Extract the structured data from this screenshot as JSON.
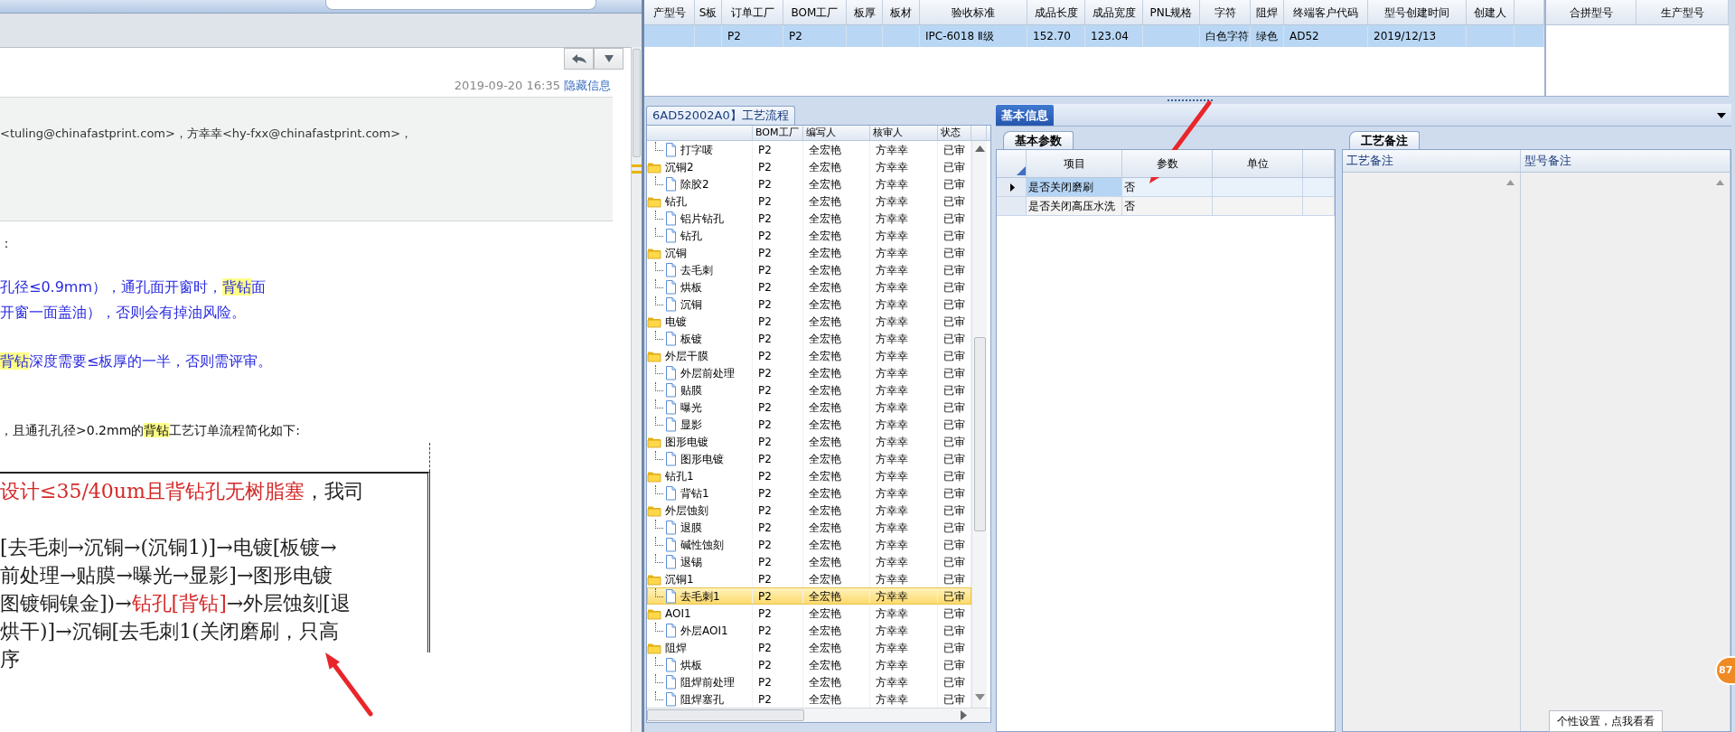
{
  "email": {
    "timestamp": "2019-09-20 16:35",
    "toggle_link": "隐藏信息",
    "recipients": "<tuling@chinafastprint.com>，方幸幸<hy-fxx@chinafastprint.com>，",
    "paragraphs": [
      {
        "kind": "plain",
        "segments": [
          {
            "text": "：",
            "highlight": false
          }
        ]
      },
      {
        "kind": "note",
        "segments": [
          {
            "text": "孔径≤0.9mm），通孔面开窗时，",
            "highlight": false
          },
          {
            "text": "背钻",
            "highlight": true
          },
          {
            "text": "面",
            "highlight": false
          }
        ]
      },
      {
        "kind": "note",
        "segments": [
          {
            "text": "开窗一面盖油），否则会有掉油风险。",
            "highlight": false
          }
        ]
      },
      {
        "kind": "note",
        "segments": [
          {
            "text": "背钻",
            "highlight": true
          },
          {
            "text": "深度需要≤板厚的一半，否则需评审。",
            "highlight": false
          }
        ]
      },
      {
        "kind": "plain",
        "segments": [
          {
            "text": "，且通孔孔径>0.2mm的",
            "highlight": false
          },
          {
            "text": "背钻",
            "highlight": true
          },
          {
            "text": "工艺订单流程简化如下:",
            "highlight": false
          }
        ]
      }
    ],
    "flow_box": [
      [
        {
          "text": "设计≤35/40um且背钻孔无树脂塞",
          "emphasis": true
        },
        {
          "text": "，我司",
          "emphasis": false
        }
      ],
      [
        {
          "text": "[去毛刺→沉铜→(沉铜1)]→电镀[板镀→",
          "emphasis": false
        }
      ],
      [
        {
          "text": "前处理→贴膜→曝光→显影]→图形电镀",
          "emphasis": false
        }
      ],
      [
        {
          "text": "图镀铜镍金])→",
          "emphasis": false
        },
        {
          "text": "钻孔[背钻]",
          "emphasis": true
        },
        {
          "text": "→外层蚀刻[退",
          "emphasis": false
        }
      ],
      [
        {
          "text": "烘干)]→沉铜[去毛刺1(关闭磨刷，只高",
          "emphasis": false
        }
      ],
      [
        {
          "text": "序",
          "emphasis": false
        }
      ]
    ]
  },
  "order_grid": {
    "columns": [
      "产型号",
      "S板",
      "订单工厂",
      "BOM工厂",
      "板厚",
      "板材",
      "验收标准",
      "成品长度",
      "成品宽度",
      "PNL规格",
      "字符",
      "阻焊",
      "终端客户代码",
      "型号创建时间",
      "创建人"
    ],
    "rows": [
      {
        "selected": true,
        "cells": [
          null,
          null,
          "P2",
          "P2",
          null,
          null,
          "IPC-6018 Ⅱ级",
          "152.70",
          "123.04",
          null,
          "白色字符",
          "绿色",
          "AD52",
          "2019/12/13",
          null
        ]
      }
    ]
  },
  "merge_grid": {
    "columns": [
      "合拼型号",
      "生产型号"
    ]
  },
  "process_panel": {
    "tab": "6AD52002A0】工艺流程",
    "columns": [
      "BOM工厂",
      "编写人",
      "核审人",
      "状态"
    ],
    "tree": [
      {
        "kind": "step",
        "name": "打字唛",
        "bom_factory": "P2",
        "author": "全宏艳",
        "reviewer": "方幸幸",
        "status": "已审",
        "selected": false
      },
      {
        "kind": "group",
        "name": "沉铜2",
        "bom_factory": "P2",
        "author": "全宏艳",
        "reviewer": "方幸幸",
        "status": "已审",
        "selected": false,
        "children": [
          {
            "kind": "step",
            "name": "除胶2",
            "bom_factory": "P2",
            "author": "全宏艳",
            "reviewer": "方幸幸",
            "status": "已审",
            "selected": false
          }
        ]
      },
      {
        "kind": "group",
        "name": "钻孔",
        "bom_factory": "P2",
        "author": "全宏艳",
        "reviewer": "方幸幸",
        "status": "已审",
        "selected": false,
        "children": [
          {
            "kind": "step",
            "name": "铝片钻孔",
            "bom_factory": "P2",
            "author": "全宏艳",
            "reviewer": "方幸幸",
            "status": "已审",
            "selected": false
          },
          {
            "kind": "step",
            "name": "钻孔",
            "bom_factory": "P2",
            "author": "全宏艳",
            "reviewer": "方幸幸",
            "status": "已审",
            "selected": false
          }
        ]
      },
      {
        "kind": "group",
        "name": "沉铜",
        "bom_factory": "P2",
        "author": "全宏艳",
        "reviewer": "方幸幸",
        "status": "已审",
        "selected": false,
        "children": [
          {
            "kind": "step",
            "name": "去毛刺",
            "bom_factory": "P2",
            "author": "全宏艳",
            "reviewer": "方幸幸",
            "status": "已审",
            "selected": false
          },
          {
            "kind": "step",
            "name": "烘板",
            "bom_factory": "P2",
            "author": "全宏艳",
            "reviewer": "方幸幸",
            "status": "已审",
            "selected": false
          },
          {
            "kind": "step",
            "name": "沉铜",
            "bom_factory": "P2",
            "author": "全宏艳",
            "reviewer": "方幸幸",
            "status": "已审",
            "selected": false
          }
        ]
      },
      {
        "kind": "group",
        "name": "电镀",
        "bom_factory": "P2",
        "author": "全宏艳",
        "reviewer": "方幸幸",
        "status": "已审",
        "selected": false,
        "children": [
          {
            "kind": "step",
            "name": "板镀",
            "bom_factory": "P2",
            "author": "全宏艳",
            "reviewer": "方幸幸",
            "status": "已审",
            "selected": false
          }
        ]
      },
      {
        "kind": "group",
        "name": "外层干膜",
        "bom_factory": "P2",
        "author": "全宏艳",
        "reviewer": "方幸幸",
        "status": "已审",
        "selected": false,
        "children": [
          {
            "kind": "step",
            "name": "外层前处理",
            "bom_factory": "P2",
            "author": "全宏艳",
            "reviewer": "方幸幸",
            "status": "已审",
            "selected": false
          },
          {
            "kind": "step",
            "name": "贴膜",
            "bom_factory": "P2",
            "author": "全宏艳",
            "reviewer": "方幸幸",
            "status": "已审",
            "selected": false
          },
          {
            "kind": "step",
            "name": "曝光",
            "bom_factory": "P2",
            "author": "全宏艳",
            "reviewer": "方幸幸",
            "status": "已审",
            "selected": false
          },
          {
            "kind": "step",
            "name": "显影",
            "bom_factory": "P2",
            "author": "全宏艳",
            "reviewer": "方幸幸",
            "status": "已审",
            "selected": false
          }
        ]
      },
      {
        "kind": "group",
        "name": "图形电镀",
        "bom_factory": "P2",
        "author": "全宏艳",
        "reviewer": "方幸幸",
        "status": "已审",
        "selected": false,
        "children": [
          {
            "kind": "step",
            "name": "图形电镀",
            "bom_factory": "P2",
            "author": "全宏艳",
            "reviewer": "方幸幸",
            "status": "已审",
            "selected": false
          }
        ]
      },
      {
        "kind": "group",
        "name": "钻孔1",
        "bom_factory": "P2",
        "author": "全宏艳",
        "reviewer": "方幸幸",
        "status": "已审",
        "selected": false,
        "children": [
          {
            "kind": "step",
            "name": "背钻1",
            "bom_factory": "P2",
            "author": "全宏艳",
            "reviewer": "方幸幸",
            "status": "已审",
            "selected": false
          }
        ]
      },
      {
        "kind": "group",
        "name": "外层蚀刻",
        "bom_factory": "P2",
        "author": "全宏艳",
        "reviewer": "方幸幸",
        "status": "已审",
        "selected": false,
        "children": [
          {
            "kind": "step",
            "name": "退膜",
            "bom_factory": "P2",
            "author": "全宏艳",
            "reviewer": "方幸幸",
            "status": "已审",
            "selected": false
          },
          {
            "kind": "step",
            "name": "碱性蚀刻",
            "bom_factory": "P2",
            "author": "全宏艳",
            "reviewer": "方幸幸",
            "status": "已审",
            "selected": false
          },
          {
            "kind": "step",
            "name": "退锡",
            "bom_factory": "P2",
            "author": "全宏艳",
            "reviewer": "方幸幸",
            "status": "已审",
            "selected": false
          }
        ]
      },
      {
        "kind": "group",
        "name": "沉铜1",
        "bom_factory": "P2",
        "author": "全宏艳",
        "reviewer": "方幸幸",
        "status": "已审",
        "selected": false,
        "children": [
          {
            "kind": "step",
            "name": "去毛刺1",
            "bom_factory": "P2",
            "author": "全宏艳",
            "reviewer": "方幸幸",
            "status": "已审",
            "selected": true
          }
        ]
      },
      {
        "kind": "group",
        "name": "AOI1",
        "bom_factory": "P2",
        "author": "全宏艳",
        "reviewer": "方幸幸",
        "status": "已审",
        "selected": false,
        "children": [
          {
            "kind": "step",
            "name": "外层AOI1",
            "bom_factory": "P2",
            "author": "全宏艳",
            "reviewer": "方幸幸",
            "status": "已审",
            "selected": false
          }
        ]
      },
      {
        "kind": "group",
        "name": "阻焊",
        "bom_factory": "P2",
        "author": "全宏艳",
        "reviewer": "方幸幸",
        "status": "已审",
        "selected": false,
        "children": [
          {
            "kind": "step",
            "name": "烘板",
            "bom_factory": "P2",
            "author": "全宏艳",
            "reviewer": "方幸幸",
            "status": "已审",
            "selected": false
          },
          {
            "kind": "step",
            "name": "阻焊前处理",
            "bom_factory": "P2",
            "author": "全宏艳",
            "reviewer": "方幸幸",
            "status": "已审",
            "selected": false
          },
          {
            "kind": "step",
            "name": "阻焊塞孔",
            "bom_factory": "P2",
            "author": "全宏艳",
            "reviewer": "方幸幸",
            "status": "已审",
            "selected": false
          }
        ]
      }
    ]
  },
  "info_panel": {
    "tab": "基本信息",
    "params": {
      "tab": "基本参数",
      "columns": [
        "项目",
        "参数",
        "单位"
      ],
      "rows": [
        {
          "item": "是否关闭磨刷",
          "value": "否",
          "selected": true
        },
        {
          "item": "是否关闭高压水洗",
          "value": "否",
          "selected": false
        }
      ]
    },
    "notes": {
      "tab": "工艺备注",
      "columns": [
        "工艺备注",
        "型号备注"
      ]
    }
  },
  "notification_badge": "87",
  "tooltip": "个性设置，点我看看"
}
